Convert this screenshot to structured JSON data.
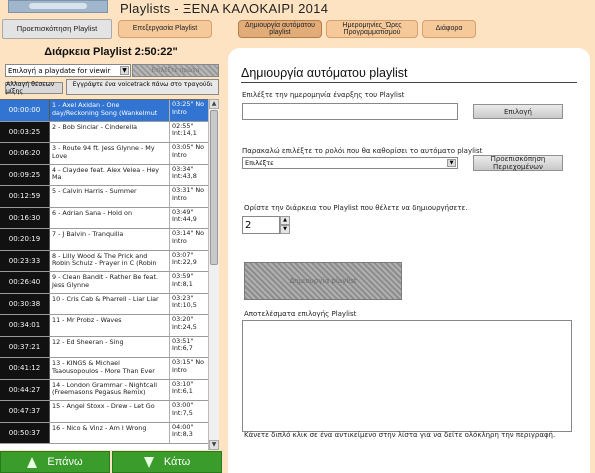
{
  "app": {
    "title": "Playlists - ΞΕΝΑ ΚΑΛΟΚΑΙΡΙ 2014"
  },
  "tabs": [
    {
      "label": "Προεπισκόπηση Playlist"
    },
    {
      "label": "Επεξεργασία Playlist"
    },
    {
      "label": "Δημιουργία αυτόματου playlist"
    },
    {
      "label": "Ημερομηνίες_Ώρες Προγραμματισμού"
    },
    {
      "label": "Διάφορα"
    }
  ],
  "left": {
    "duration_title": "Διάρκεια Playlist 2:50:22\"",
    "date_select": "Επιλογή a playdate for viewir",
    "disabled_btn": "Επιλέξτε πρώτα",
    "swap_btn": "Αλλαγή θέσεων μίξης",
    "voice_btn": "Εγγράψτε ένα voicetrack πάνω στο τραγούδι",
    "rows": [
      {
        "time": "00:00:00",
        "title": "1 - Axel Axidan - One day/Reckoning Song (Wankelmut",
        "dur": "03:25\" No Intro"
      },
      {
        "time": "00:03:25",
        "title": "2 - Bob Sinclar - Cinderella",
        "dur": "02:55\" Int:14,1"
      },
      {
        "time": "00:06:20",
        "title": "3 - Route 94 ft. Jess Glynne - My Love",
        "dur": "03:05\" No Intro"
      },
      {
        "time": "00:09:25",
        "title": "4 - Claydee feat. Alex Velea - Hey Ma",
        "dur": "03:34\" Int:43,8"
      },
      {
        "time": "00:12:59",
        "title": "5 - Calvin Harris - Summer",
        "dur": "03:31\" No Intro"
      },
      {
        "time": "00:16:30",
        "title": "6 - Adrian Sana - Hold on",
        "dur": "03:49\" Int:44,9"
      },
      {
        "time": "00:20:19",
        "title": "7 - J Balvin - Tranquilla",
        "dur": "03:14\" No Intro"
      },
      {
        "time": "00:23:33",
        "title": "8 - Lilly Wood & The Prick and Robin Schulz - Prayer in C (Robin",
        "dur": "03:07\" Int:22,9"
      },
      {
        "time": "00:26:40",
        "title": "9 - Clean Bandit - Rather Be feat. Jess Glynne",
        "dur": "03:59\" Int:8,1"
      },
      {
        "time": "00:30:38",
        "title": "10 - Cris Cab & Pharrell - Liar Liar",
        "dur": "03:23\" Int:10,5"
      },
      {
        "time": "00:34:01",
        "title": "11 - Mr Probz - Waves",
        "dur": "03:20\" Int:24,5"
      },
      {
        "time": "00:37:21",
        "title": "12 - Ed Sheeran - Sing",
        "dur": "03:51\" Int:6,7"
      },
      {
        "time": "00:41:12",
        "title": "13 - KINGS & Michael Tsaousopoulos - More Than Ever",
        "dur": "03:15\" No Intro"
      },
      {
        "time": "00:44:27",
        "title": "14 - London Grammar - Nightcall (Freemasons Pegasus Remix)",
        "dur": "03:10\" Int:6,1"
      },
      {
        "time": "00:47:37",
        "title": "15 - Angel Stoxx - Drew - Let Go",
        "dur": "03:00\" Int:7,5"
      },
      {
        "time": "00:50:37",
        "title": "16 - Nico & Vinz - Am I Wrong",
        "dur": "04:00\" Int:8,3"
      }
    ],
    "up_label": "Επάνω",
    "down_label": "Κάτω"
  },
  "right": {
    "heading": "Δημιουργία αυτόματου playlist",
    "start_date_label": "Επιλέξτε την ημερομηνία έναρξης του Playlist",
    "start_date_value": "",
    "select_button": "Επιλογή",
    "role_label": "Παρακαλώ επιλέξτε το ρολόι που θα καθορίσει το αυτόματο playlist",
    "role_select_value": "Επιλέξτε",
    "preview_button": "Προεπισκόπηση Περιεχομένων",
    "duration_label": "Ορίστε την διάρκεια του Playlist που θέλετε να δημιουργήσετε.",
    "duration_value": "2",
    "create_button": "Δημιουργία playlist",
    "results_label": "Αποτελέσματα επιλογής Playlist",
    "footer_hint": "Κάνετε διπλό κλικ σε ένα αντικείμενο στην λίστα για να δείτε ολόκληρη την περιγραφή."
  }
}
